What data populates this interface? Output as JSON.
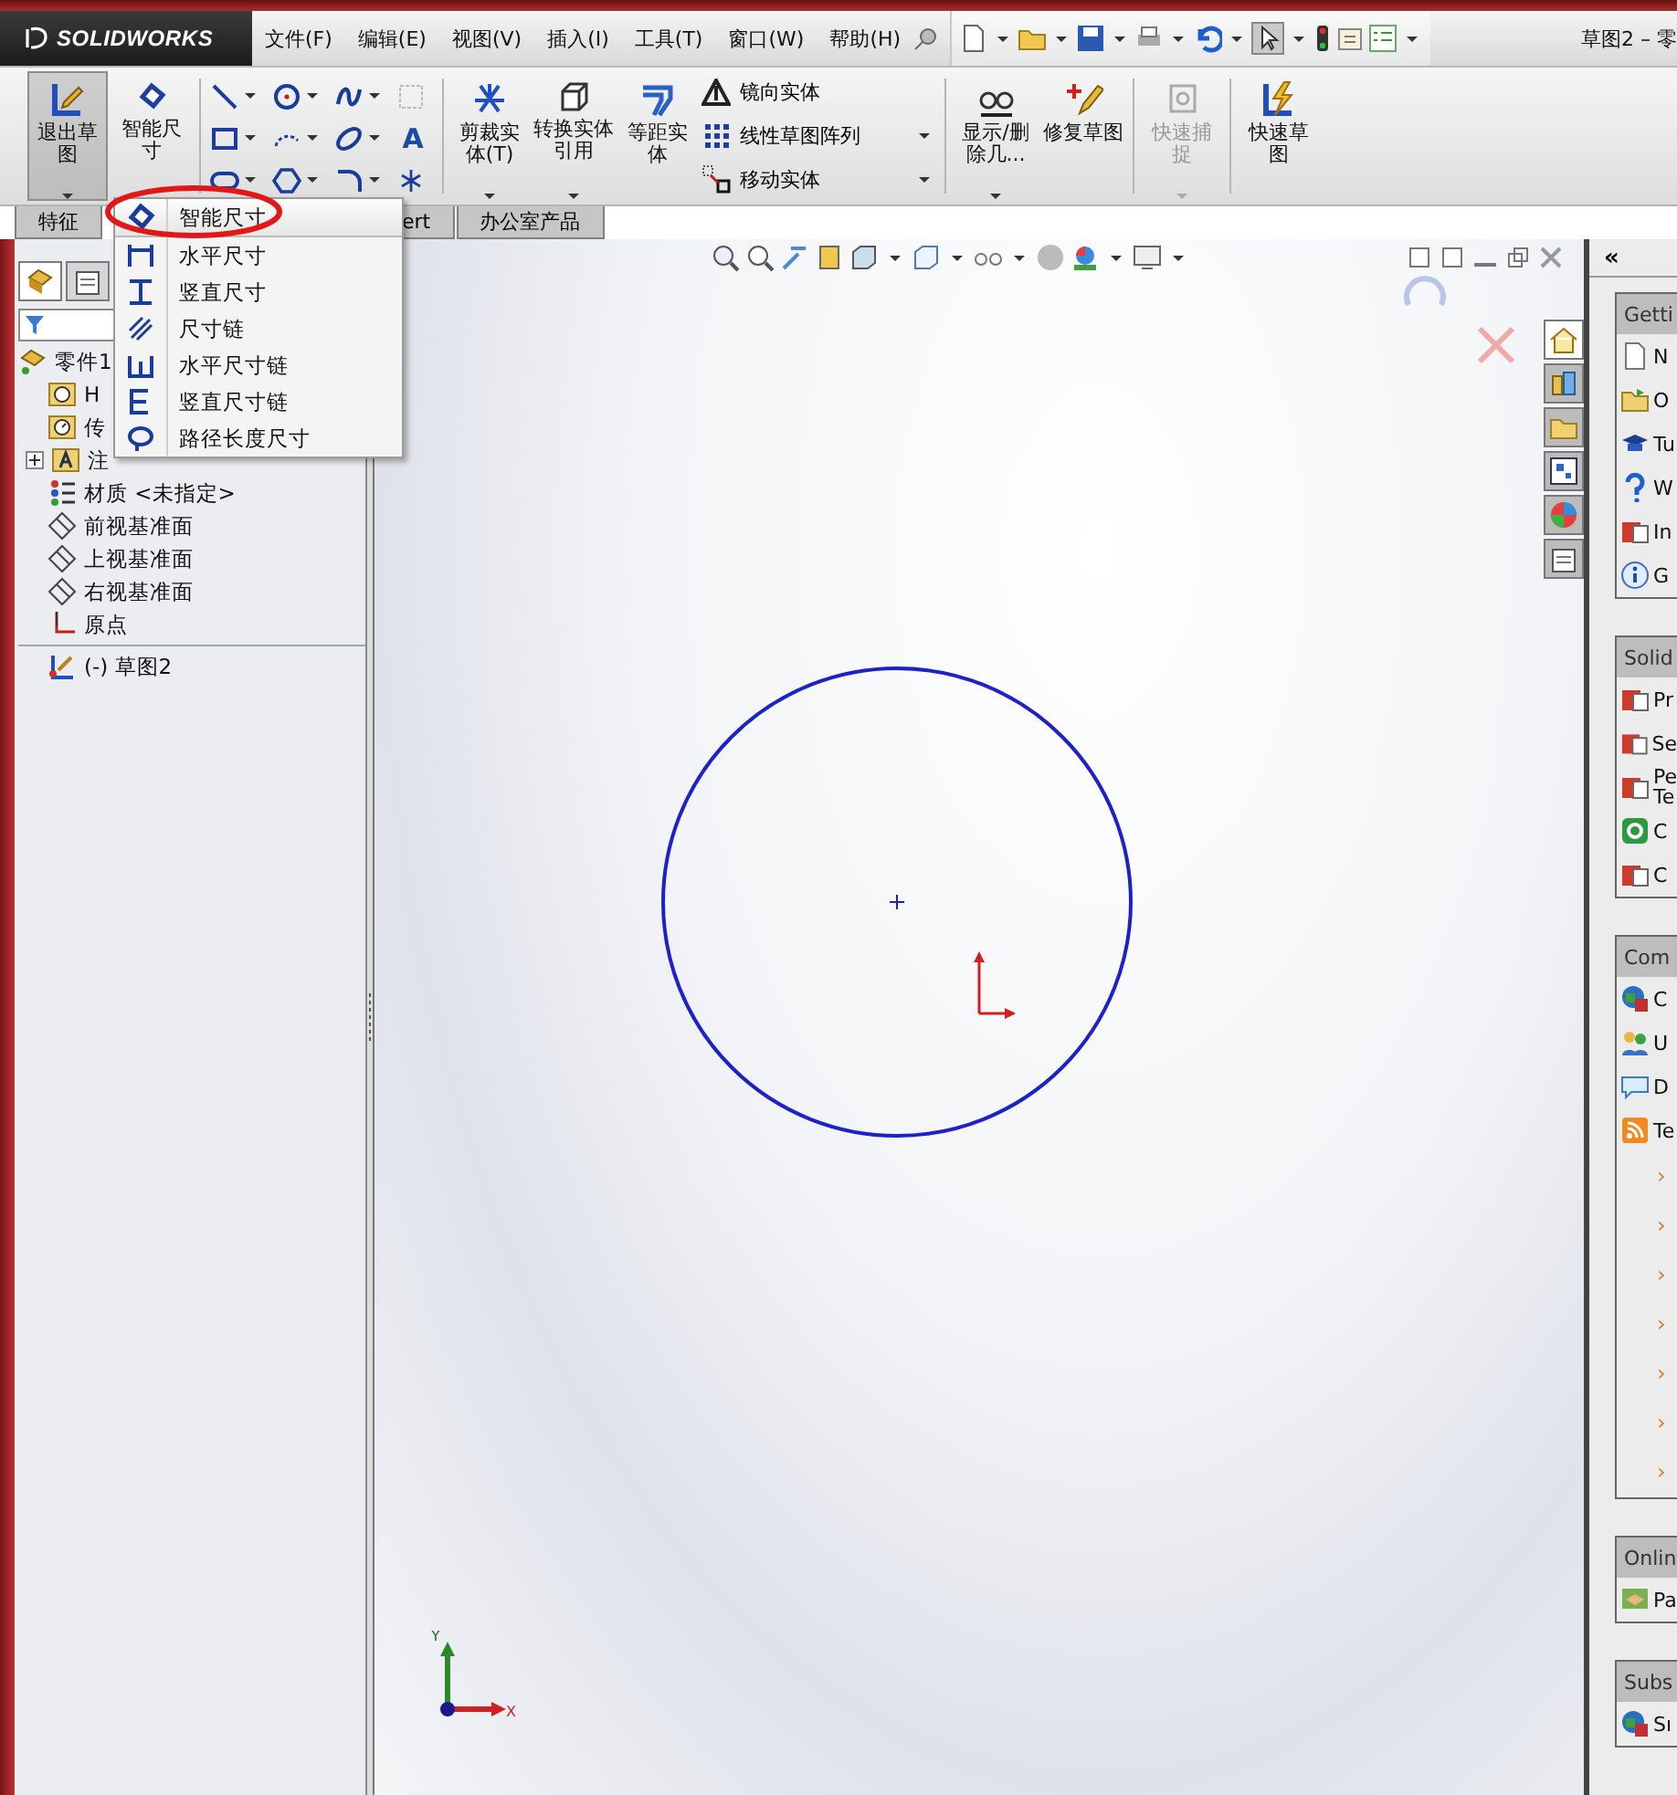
{
  "menubar": {
    "logo": "SOLIDWORKS",
    "items": [
      "文件(F)",
      "编辑(E)",
      "视图(V)",
      "插入(I)",
      "工具(T)",
      "窗口(W)",
      "帮助(H)"
    ],
    "title": "草图2 – 零"
  },
  "ribbon": {
    "main_buttons": [
      {
        "label": "退出草图",
        "kind": "exit",
        "selected": true,
        "dropdown": true
      },
      {
        "label": "智能尺寸",
        "kind": "dimension",
        "selected": false,
        "dropdown": false
      }
    ],
    "text_tool_glyph": "A",
    "tool_buttons": [
      {
        "label": "剪裁实体(T)",
        "kind": "trim",
        "disabled": false,
        "dropdown": true
      },
      {
        "label": "转换实体引用",
        "kind": "convert",
        "disabled": false,
        "dropdown": true
      },
      {
        "label": "等距实体",
        "kind": "offset",
        "disabled": false,
        "dropdown": false
      }
    ],
    "list_tools": [
      {
        "label": "镜向实体",
        "kind": "mirror",
        "dropdown": false
      },
      {
        "label": "线性草图阵列",
        "kind": "pattern",
        "dropdown": true
      },
      {
        "label": "移动实体",
        "kind": "move",
        "dropdown": true
      }
    ],
    "more_buttons": [
      {
        "label": "显示/删除几...",
        "kind": "relations",
        "disabled": false,
        "dropdown": true
      },
      {
        "label": "修复草图",
        "kind": "repair",
        "disabled": false,
        "dropdown": false
      },
      {
        "label": "快速捕捉",
        "kind": "snap",
        "disabled": true,
        "dropdown": true
      },
      {
        "label": "快速草图",
        "kind": "quick",
        "disabled": false,
        "dropdown": false
      }
    ]
  },
  "tabs": [
    {
      "label": "特征",
      "selected": false
    },
    {
      "label": "ert",
      "selected": false
    },
    {
      "label": "办公室产品",
      "selected": false
    }
  ],
  "dimension_menu": [
    {
      "label": "智能尺寸",
      "kind": "smart",
      "selected": true
    },
    {
      "label": "水平尺寸",
      "kind": "horizontal",
      "selected": false
    },
    {
      "label": "竖直尺寸",
      "kind": "vertical",
      "selected": false
    },
    {
      "label": "尺寸链",
      "kind": "chain",
      "selected": false
    },
    {
      "label": "水平尺寸链",
      "kind": "hchain",
      "selected": false
    },
    {
      "label": "竖直尺寸链",
      "kind": "vchain",
      "selected": false
    },
    {
      "label": "路径长度尺寸",
      "kind": "path",
      "selected": false
    }
  ],
  "feature_tree": {
    "root": "零件1",
    "children": [
      {
        "label": "H",
        "kind": "history",
        "has_children": false
      },
      {
        "label": "传",
        "kind": "sensor",
        "has_children": false
      },
      {
        "label": "注",
        "kind": "annotation",
        "has_children": true
      },
      {
        "label": "材质 <未指定>",
        "kind": "material",
        "has_children": false
      },
      {
        "label": "前视基准面",
        "kind": "plane",
        "has_children": false
      },
      {
        "label": "上视基准面",
        "kind": "plane",
        "has_children": false
      },
      {
        "label": "右视基准面",
        "kind": "plane",
        "has_children": false
      },
      {
        "label": "原点",
        "kind": "origin",
        "has_children": false
      }
    ],
    "sketch": "(-) 草图2"
  },
  "canvas": {
    "axis_x": "X",
    "axis_y": "Y"
  },
  "task_pane": {
    "collapse": "«",
    "tabs": [
      {
        "kind": "home",
        "selected": true
      },
      {
        "kind": "library",
        "selected": false
      },
      {
        "kind": "folder",
        "selected": false
      },
      {
        "kind": "palette",
        "selected": false
      },
      {
        "kind": "appearance",
        "selected": false
      },
      {
        "kind": "properties",
        "selected": false
      }
    ],
    "sections": [
      {
        "title": "Getti",
        "items": [
          {
            "label": "N",
            "kind": "doc"
          },
          {
            "label": "O",
            "kind": "folder"
          },
          {
            "label": "Tu",
            "kind": "cap"
          },
          {
            "label": "W",
            "kind": "help"
          },
          {
            "label": "In",
            "kind": "box"
          },
          {
            "label": "G",
            "kind": "info"
          }
        ]
      },
      {
        "title": "Solid",
        "items": [
          {
            "label": "Pr",
            "kind": "box"
          },
          {
            "label": "Se",
            "kind": "box"
          },
          {
            "label": "Pe\nTe",
            "kind": "box"
          },
          {
            "label": "C",
            "kind": "green"
          },
          {
            "label": "C",
            "kind": "box"
          }
        ]
      },
      {
        "title": "Com",
        "items": [
          {
            "label": "C",
            "kind": "globe"
          },
          {
            "label": "U",
            "kind": "users"
          },
          {
            "label": "D",
            "kind": "chat"
          },
          {
            "label": "Te",
            "kind": "rss"
          }
        ],
        "feed": [
          "›",
          "›",
          "›",
          "›",
          "›",
          "›",
          "›"
        ]
      },
      {
        "title": "Onlin",
        "items": [
          {
            "label": "Pa",
            "kind": "hand"
          }
        ]
      },
      {
        "title": "Subs",
        "items": [
          {
            "label": "Sı",
            "kind": "globe"
          }
        ]
      }
    ]
  }
}
